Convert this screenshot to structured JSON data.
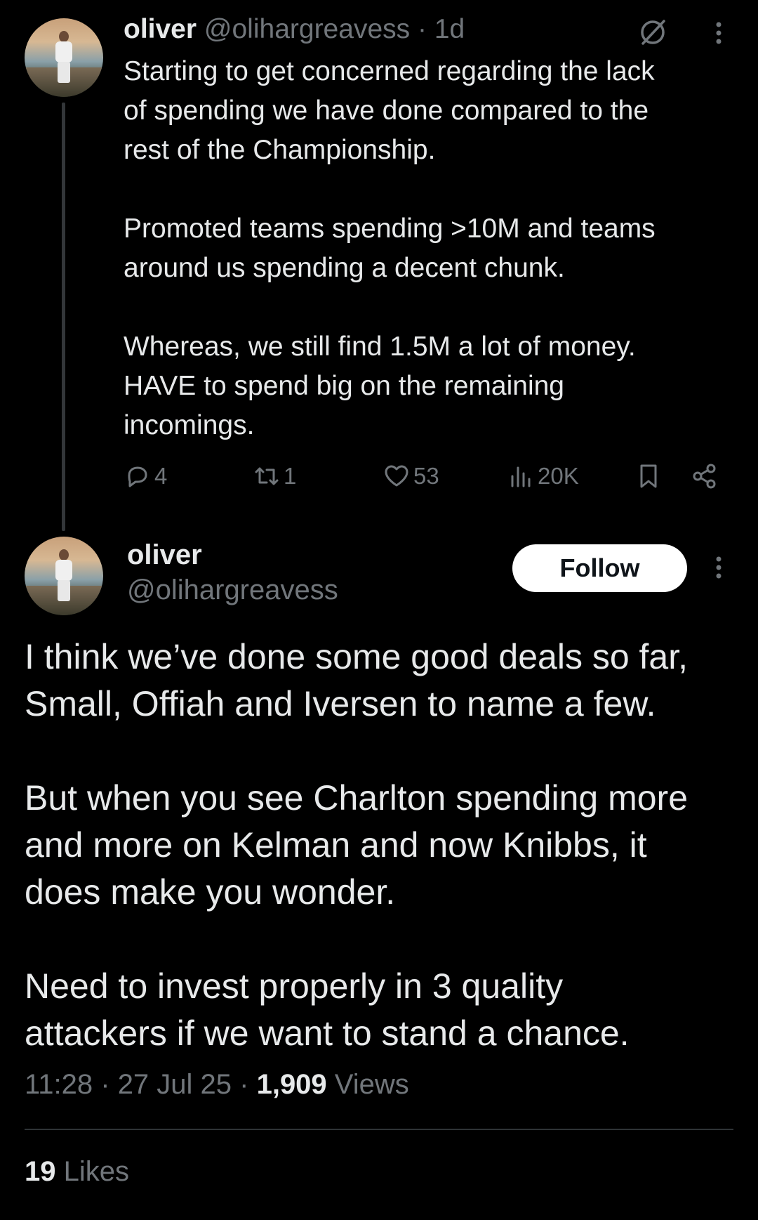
{
  "tweet1": {
    "name": "oliver",
    "handle": "@olihargreavess",
    "separator": " · ",
    "time": "1d",
    "body": "Starting to get concerned regarding the lack\nof spending we have done compared to the\nrest of the Championship.\n\nPromoted teams spending >10M and teams\naround us spending a decent chunk.\n\nWhereas, we still find 1.5M a lot of money.\nHAVE to spend big on the remaining\nincomings.",
    "replies": "4",
    "reposts": "1",
    "likes": "53",
    "views": "20K"
  },
  "tweet2": {
    "name": "oliver",
    "handle": "@olihargreavess",
    "follow_label": "Follow",
    "body": "I think we’ve done some good deals so far,\nSmall, Offiah and Iversen to name a few.\n\nBut when you see Charlton spending more\nand more on Kelman and now Knibbs, it\ndoes make you wonder.\n\nNeed to invest properly in 3 quality\nattackers if we want to stand a chance.",
    "time": "11:28",
    "date": "27 Jul 25",
    "meta_sep": " · ",
    "views_count": "1,909",
    "views_label": " Views",
    "likes_count": "19",
    "likes_label": " Likes"
  },
  "colors": {
    "background": "#000000",
    "text": "#e7e9ea",
    "secondary": "#71767b",
    "follow_bg": "#ffffff"
  }
}
